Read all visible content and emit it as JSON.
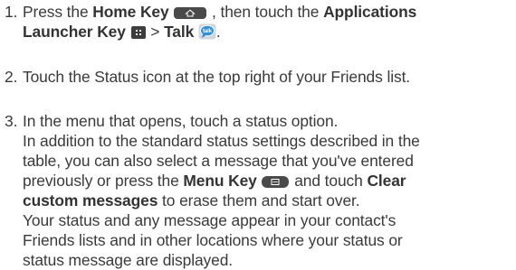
{
  "steps": [
    {
      "number": "1.",
      "line1_a": "Press the ",
      "line1_home": "Home Key",
      "line1_b": " , then touch the ",
      "line1_apps": "Applications",
      "line2_apps": "Launcher Key",
      "line2_gt": " > ",
      "line2_talk": "Talk",
      "line2_end": "."
    },
    {
      "number": "2.",
      "text": "Touch the Status icon at the top right of your Friends list."
    },
    {
      "number": "3.",
      "lines": [
        "In the menu that opens, touch a status option.",
        "In addition to the standard status settings described in the",
        "table, you can also select a message that you've entered"
      ],
      "line4_a": "previously or press the ",
      "line4_menu": "Menu Key",
      "line4_b": " and touch ",
      "line4_clear": "Clear",
      "line5_bold": "custom messages",
      "line5_rest": " to erase them and start over.",
      "tail_lines": [
        "Your status and any message appear in your contact's",
        "Friends lists and in other locations where your status or",
        "status message are displayed."
      ]
    }
  ],
  "icons": {
    "home_key": "home-key-icon",
    "apps_key": "applications-launcher-key-icon",
    "talk_app": "talk-app-icon",
    "menu_key": "menu-key-icon"
  }
}
